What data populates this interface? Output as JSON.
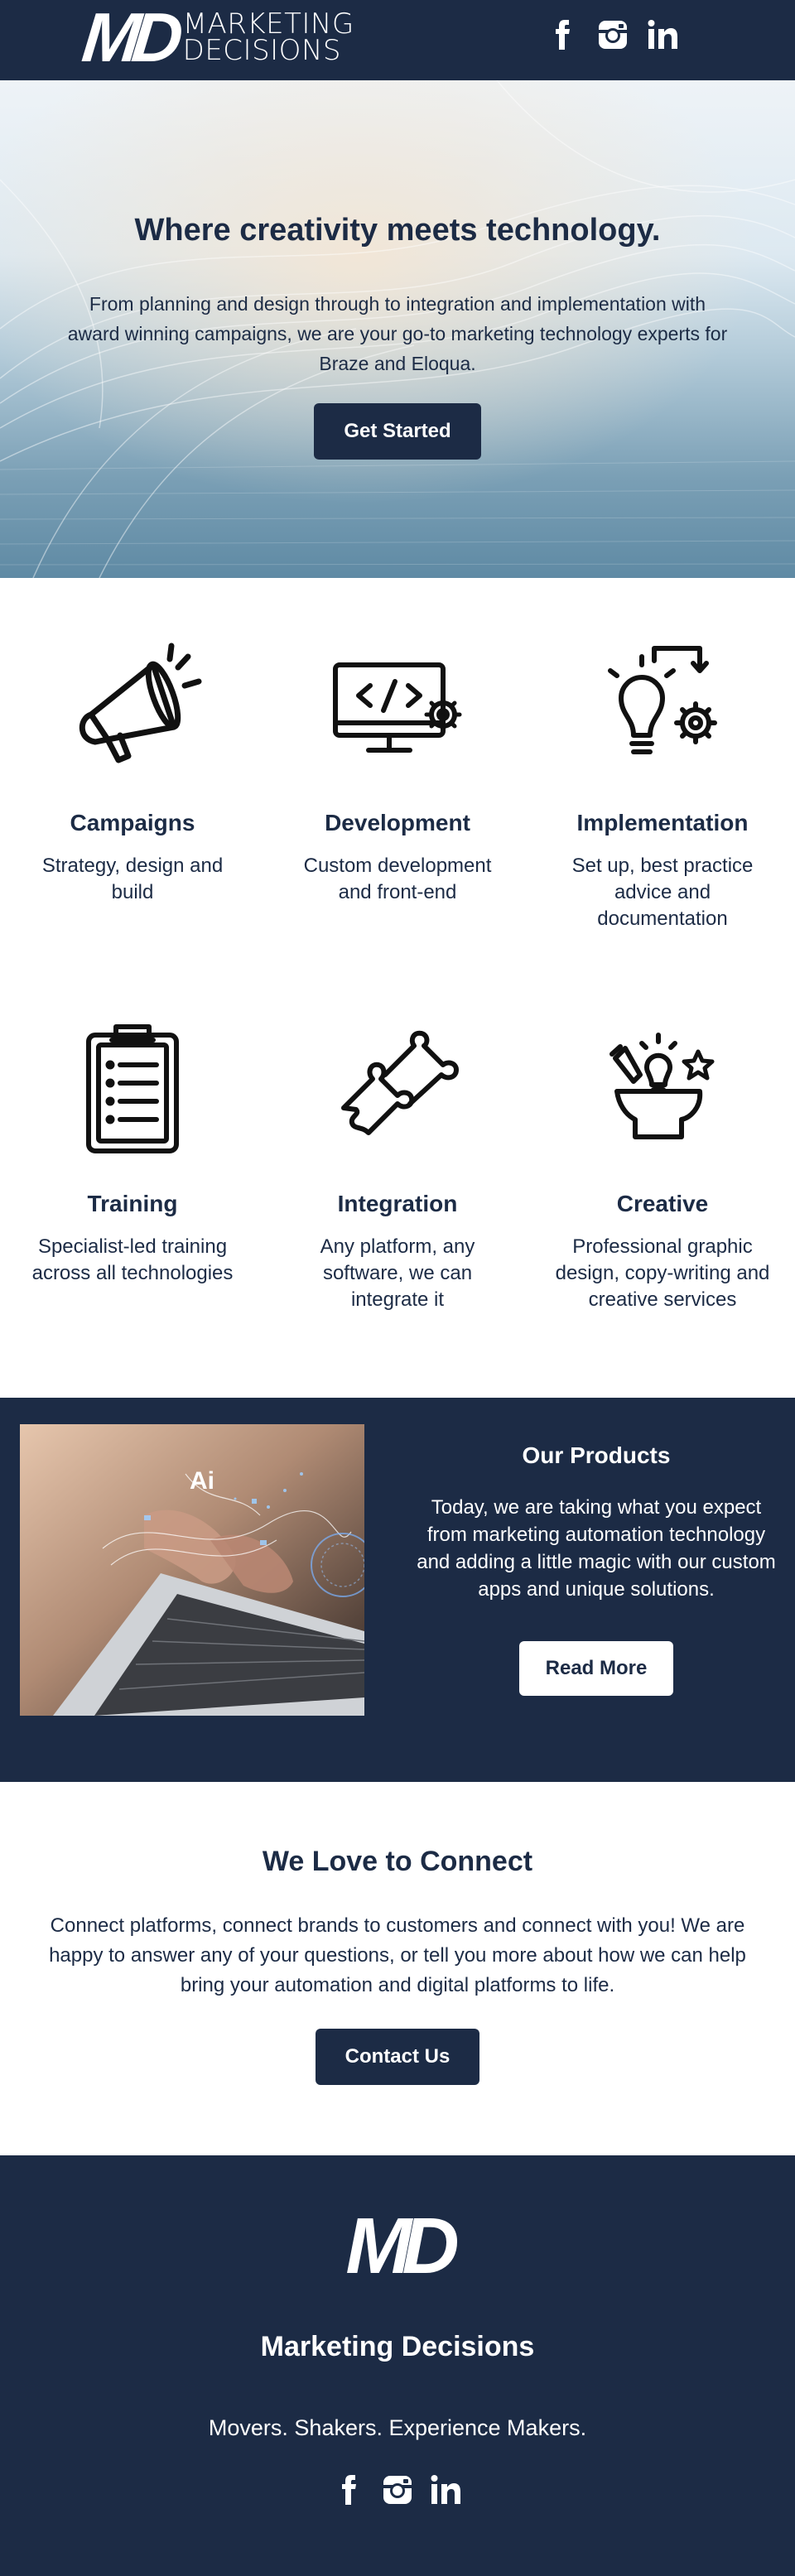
{
  "header": {
    "logo_mark": "MD",
    "logo_line1": "MARKETING",
    "logo_line2": "DECISIONS",
    "social": [
      "facebook-icon",
      "instagram-icon",
      "linkedin-icon"
    ]
  },
  "hero": {
    "title": "Where creativity meets technology.",
    "body": "From planning and design through to integration and implementation with award winning campaigns, we are your go-to marketing technology experts for Braze and Eloqua.",
    "cta": "Get Started"
  },
  "services": [
    {
      "icon": "megaphone-icon",
      "title": "Campaigns",
      "desc": "Strategy, design and build"
    },
    {
      "icon": "code-monitor-icon",
      "title": "Development",
      "desc": "Custom development and front-end"
    },
    {
      "icon": "lightbulb-gear-icon",
      "title": "Implementation",
      "desc": "Set up, best practice advice and documentation"
    },
    {
      "icon": "clipboard-icon",
      "title": "Training",
      "desc": "Specialist-led training across all technologies"
    },
    {
      "icon": "puzzle-icon",
      "title": "Integration",
      "desc": "Any platform, any software, we can integrate it"
    },
    {
      "icon": "creative-head-icon",
      "title": "Creative",
      "desc": "Professional graphic design, copy-writing and creative services"
    }
  ],
  "products": {
    "image_label": "Ai",
    "title": "Our Products",
    "body": "Today, we are taking what you expect from marketing automation technology and adding a little magic with our custom apps and unique solutions.",
    "cta": "Read More"
  },
  "connect": {
    "title": "We Love to Connect",
    "body": "Connect platforms, connect brands to customers and connect with you! We are happy to answer any of your questions, or tell you more about how we can help bring your automation and digital platforms to life.",
    "cta": "Contact Us"
  },
  "footer": {
    "logo_mark": "MD",
    "company": "Marketing Decisions",
    "tagline": "Movers. Shakers. Experience Makers."
  },
  "colors": {
    "navy": "#1c2b45",
    "white": "#ffffff"
  }
}
